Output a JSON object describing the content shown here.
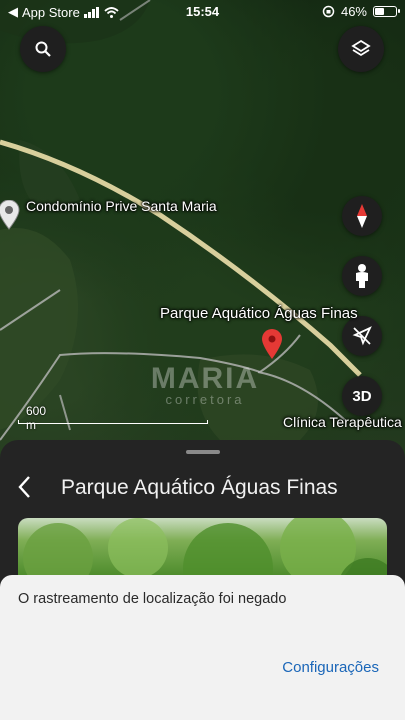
{
  "status_bar": {
    "carrier": "App Store",
    "time": "15:54",
    "battery": "46%",
    "battery_level": 0.46
  },
  "map": {
    "labels": {
      "condominium": "Condomínio Prive Santa Maria",
      "water_park": "Parque Aquático Águas Finas",
      "clinic": "Clínica Terapêutica"
    },
    "scale": "600 m",
    "watermark": {
      "main": "MARIA",
      "sub": "corretora"
    },
    "buttons": {
      "three_d": "3D"
    },
    "pin_color": "#e53935"
  },
  "sheet": {
    "title": "Parque Aquático Águas Finas"
  },
  "toast": {
    "message": "O rastreamento de localização foi negado",
    "action": "Configurações"
  }
}
